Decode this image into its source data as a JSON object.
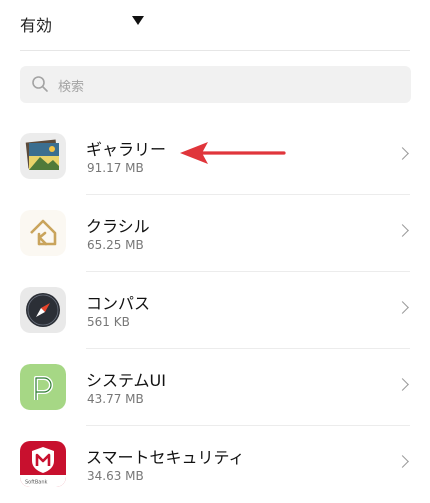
{
  "header": {
    "filter_label": "有効"
  },
  "search": {
    "placeholder": "検索"
  },
  "apps": [
    {
      "name": "ギャラリー",
      "size": "91.17 MB",
      "icon": "gallery-icon"
    },
    {
      "name": "クラシル",
      "size": "65.25 MB",
      "icon": "kurashiru-icon"
    },
    {
      "name": "コンパス",
      "size": "561 KB",
      "icon": "compass-icon"
    },
    {
      "name": "システムUI",
      "size": "43.77 MB",
      "icon": "system-ui-icon"
    },
    {
      "name": "スマートセキュリティ",
      "size": "34.63 MB",
      "icon": "smart-security-icon",
      "icon_caption": "SoftBank"
    }
  ],
  "colors": {
    "annotation_arrow": "#e0353b",
    "security_red": "#c8102e",
    "systemui_green": "#a6d785"
  }
}
